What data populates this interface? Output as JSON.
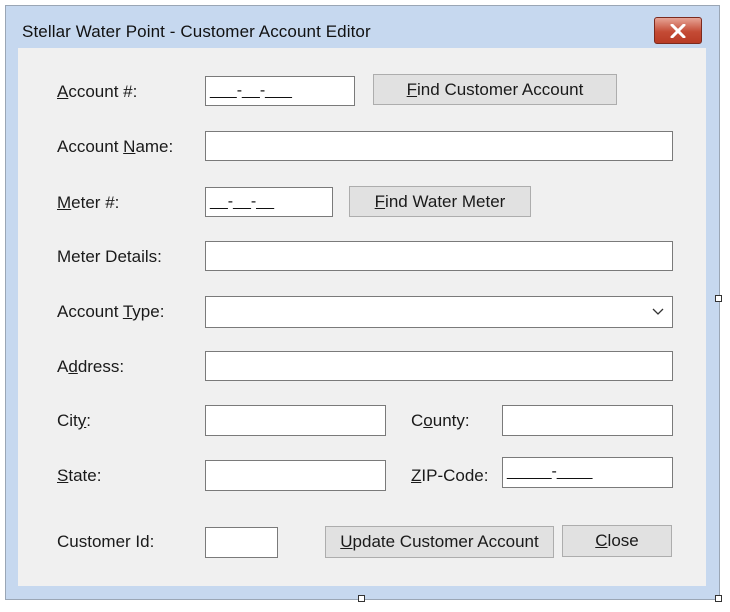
{
  "window": {
    "title": "Stellar Water Point - Customer Account Editor",
    "close_icon": "close-icon"
  },
  "form": {
    "account_number": {
      "label_pre": "",
      "label_key": "A",
      "label_post": "ccount #:",
      "value": "___-__-___"
    },
    "find_account_button": {
      "pre": "",
      "key": "F",
      "post": "ind Customer Account"
    },
    "account_name": {
      "label_pre": "Account ",
      "label_key": "N",
      "label_post": "ame:",
      "value": ""
    },
    "meter_number": {
      "label_pre": "",
      "label_key": "M",
      "label_post": "eter #:",
      "value": "__-__-__"
    },
    "find_meter_button": {
      "pre": "",
      "key": "F",
      "post": "ind Water Meter"
    },
    "meter_details": {
      "label": "Meter Details:",
      "value": ""
    },
    "account_type": {
      "label_pre": "Account ",
      "label_key": "T",
      "label_post": "ype:",
      "value": ""
    },
    "address": {
      "label_pre": "A",
      "label_key": "d",
      "label_post": "dress:",
      "value": ""
    },
    "city": {
      "label_pre": "Cit",
      "label_key": "y",
      "label_post": ":",
      "value": ""
    },
    "county": {
      "label_pre": "C",
      "label_key": "o",
      "label_post": "unty:",
      "value": ""
    },
    "state": {
      "label_pre": "",
      "label_key": "S",
      "label_post": "tate:",
      "value": ""
    },
    "zip_code": {
      "label_pre": "",
      "label_key": "Z",
      "label_post": "IP-Code:",
      "value": "_____-____"
    },
    "customer_id": {
      "label": "Customer Id:",
      "value": ""
    },
    "update_button": {
      "pre": "",
      "key": "U",
      "post": "pdate Customer Account"
    },
    "close_button": {
      "pre": "",
      "key": "C",
      "post": "lose"
    }
  },
  "colors": {
    "frame": "#c6d8ef",
    "client": "#f0f0f0",
    "close_red": "#c44b35"
  }
}
